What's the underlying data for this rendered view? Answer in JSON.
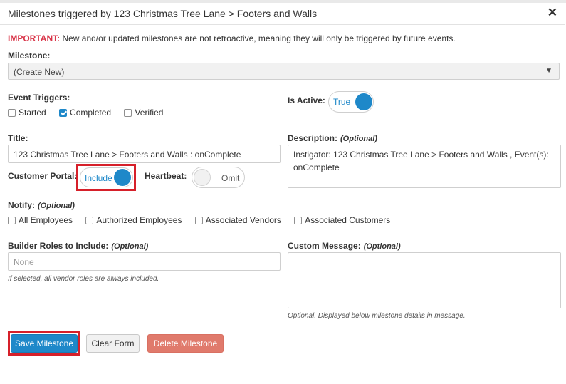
{
  "dialog": {
    "title": "Milestones triggered by 123 Christmas Tree Lane > Footers and Walls",
    "close_glyph": "✕"
  },
  "notice": {
    "important_label": "IMPORTANT:",
    "text": " New and/or updated milestones are not retroactive, meaning they will only be triggered by future events."
  },
  "milestone": {
    "label": "Milestone:",
    "selected": "(Create New)"
  },
  "event_triggers": {
    "label": "Event Triggers:",
    "options": [
      {
        "label": "Started",
        "checked": false
      },
      {
        "label": "Completed",
        "checked": true
      },
      {
        "label": "Verified",
        "checked": false
      }
    ]
  },
  "is_active": {
    "label": "Is Active:",
    "value_text": "True",
    "on": true
  },
  "title_field": {
    "label": "Title:",
    "value": "123 Christmas Tree Lane > Footers and Walls : onComplete"
  },
  "description": {
    "label": "Description:",
    "optional": "(Optional)",
    "value": "Instigator: 123 Christmas Tree Lane > Footers and Walls , Event(s): onComplete"
  },
  "customer_portal": {
    "label": "Customer Portal:",
    "value_text": "Include",
    "on": true
  },
  "heartbeat": {
    "label": "Heartbeat:",
    "value_text": "Omit",
    "on": false
  },
  "notify": {
    "label": "Notify:",
    "optional": "(Optional)",
    "options": [
      {
        "label": "All Employees",
        "checked": false
      },
      {
        "label": "Authorized Employees",
        "checked": false
      },
      {
        "label": "Associated Vendors",
        "checked": false
      },
      {
        "label": "Associated Customers",
        "checked": false
      }
    ]
  },
  "builder_roles": {
    "label": "Builder Roles to Include:",
    "optional": "(Optional)",
    "placeholder": "None",
    "hint": "If selected, all vendor roles are always included."
  },
  "custom_message": {
    "label": "Custom Message:",
    "optional": "(Optional)",
    "value": "",
    "hint": "Optional. Displayed below milestone details in message."
  },
  "buttons": {
    "save": "Save Milestone",
    "clear": "Clear Form",
    "delete": "Delete Milestone"
  },
  "colors": {
    "accent": "#1e88c9",
    "important": "#d9364a",
    "highlight_box": "#d6202a",
    "danger_button": "#e07a6c"
  }
}
